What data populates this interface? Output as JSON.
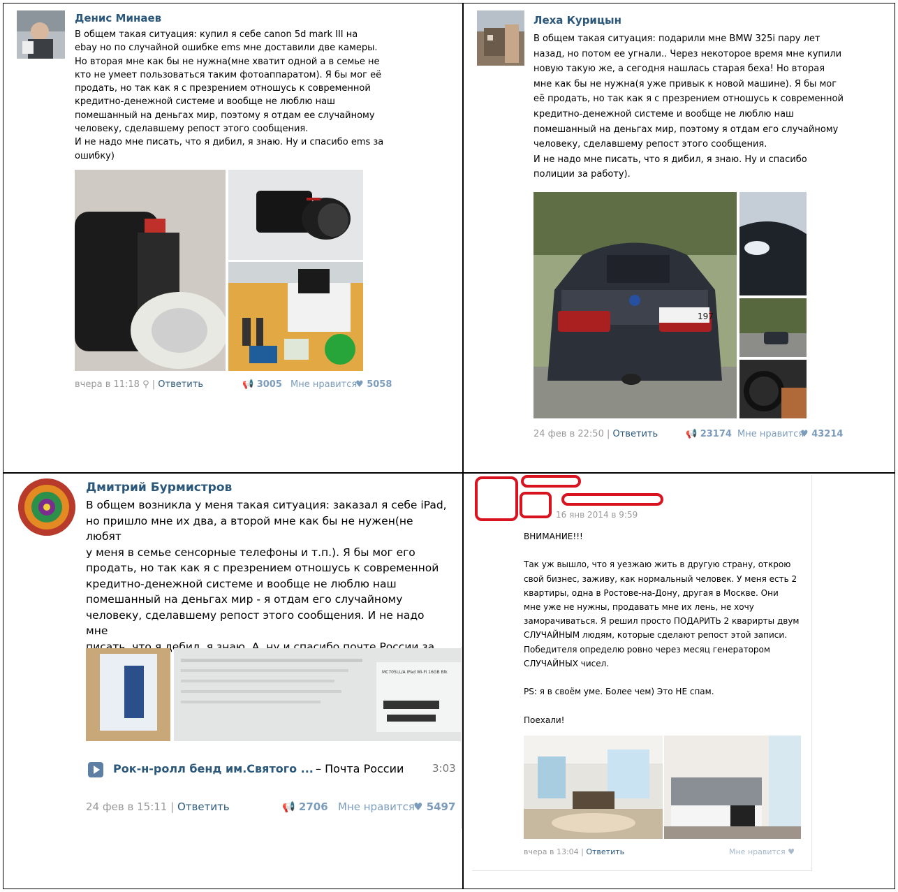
{
  "posts": [
    {
      "author": "Денис Минаев",
      "text": "В общем такая ситуация: купил я себе canon 5d mark III на\nebay но по случайной ошибке ems мне доставили две камеры.\nНо вторая мне как бы не нужна(мне хватит одной а в семье не\nкто не умеет пользоваться таким фотоаппаратом). Я бы мог её\nпродать, но так как я с презрением отношусь к современной\nкредитно-денежной системе и вообще не люблю наш\nпомешанный на деньгах мир, поэтому я отдам ее случайному\nчеловеку, сделавшему репост этого сообщения.\nИ не надо мне писать, что я дибил, я знаю. Ну и спасибо ems за\nошибку)",
      "time": "вчера в 11:18",
      "reply": "Ответить",
      "reposts": "3005",
      "likes_label": "Мне нравится",
      "likes": "5058"
    },
    {
      "author": "Леха Курицын",
      "text": "В общем такая ситуация: подарили мне BMW 325i пару лет\nназад, но потом ее угнали.. Через некоторое время мне купили\nновую такую же, а сегодня нашлась старая беха! Но вторая\nмне как бы не нужна(я уже привык к новой машине). Я бы мог\nеё продать, но так как я с презрением отношусь к современной\nкредитно-денежной системе и вообще не люблю наш\nпомешанный на деньгах мир, поэтому я отдам его случайному\nчеловеку, сделавшему репост этого сообщения.\nИ не надо мне писать, что я дибил, я знаю. Ну и спасибо\nполиции за работу).",
      "time": "24 фев в 22:50",
      "reply": "Ответить",
      "reposts": "23174",
      "likes_label": "Мне нравится",
      "likes": "43214",
      "plate": "197"
    },
    {
      "author": "Дмитрий Бурмистров",
      "text": "В общем возникла у меня такая ситуация: заказал я себе iPad,\nно пришло мне их два, а второй мне как бы не нужен(не любят\nу меня в семье сенсорные телефоны и т.п.). Я бы мог его\nпродать, но так как я с презрением отношусь к современной\nкредитно-денежной системе и вообще не люблю наш\nпомешанный на деньгах мир - я отдам его случайному\nчеловеку, сделавшему репост этого сообщения. И не надо мне\nписать, что я дебил, я знаю. А, ну и спасибо почте России за\nподарок :)",
      "audio_title": "Рок-н-ролл бенд им.Святого ...",
      "audio_artist": "– Почта России",
      "audio_duration": "3:03",
      "time": "24 фев в 15:11",
      "reply": "Ответить",
      "reposts": "2706",
      "likes_label": "Мне нравится",
      "likes": "5497",
      "label_model": "MC705LL/A iPad Wi-Fi 16GB Blk"
    },
    {
      "date": "16 янв 2014 в 9:59",
      "text": "ВНИМАНИЕ!!!\n\nТак уж вышло, что я уезжаю жить в другую страну, открою\nсвой бизнес, заживу, как нормальный человек. У меня есть 2\nквартиры, одна в Ростове-на-Дону, другая в Москве. Они\nмне уже не нужны, продавать мне их лень, не хочу\nзаморачиваться. Я решил просто ПОДАРИТЬ 2 кварирты двум\nСЛУЧАЙНЫМ людям, которые сделают репост этой записи.\nПобедителя определю ровно через месяц генератором\nСЛУЧАЙНЫХ чисел.\n\nPS: я в своём уме. Более чем) Это НЕ спам.\n\nПоехали!",
      "time": "вчера в 13:04",
      "reply": "Ответить",
      "likes_label": "Мне нравится"
    }
  ],
  "colors": {
    "link": "#2b587a",
    "meta": "#999999",
    "stat": "#7c9cbc",
    "redact": "#d9121f"
  }
}
